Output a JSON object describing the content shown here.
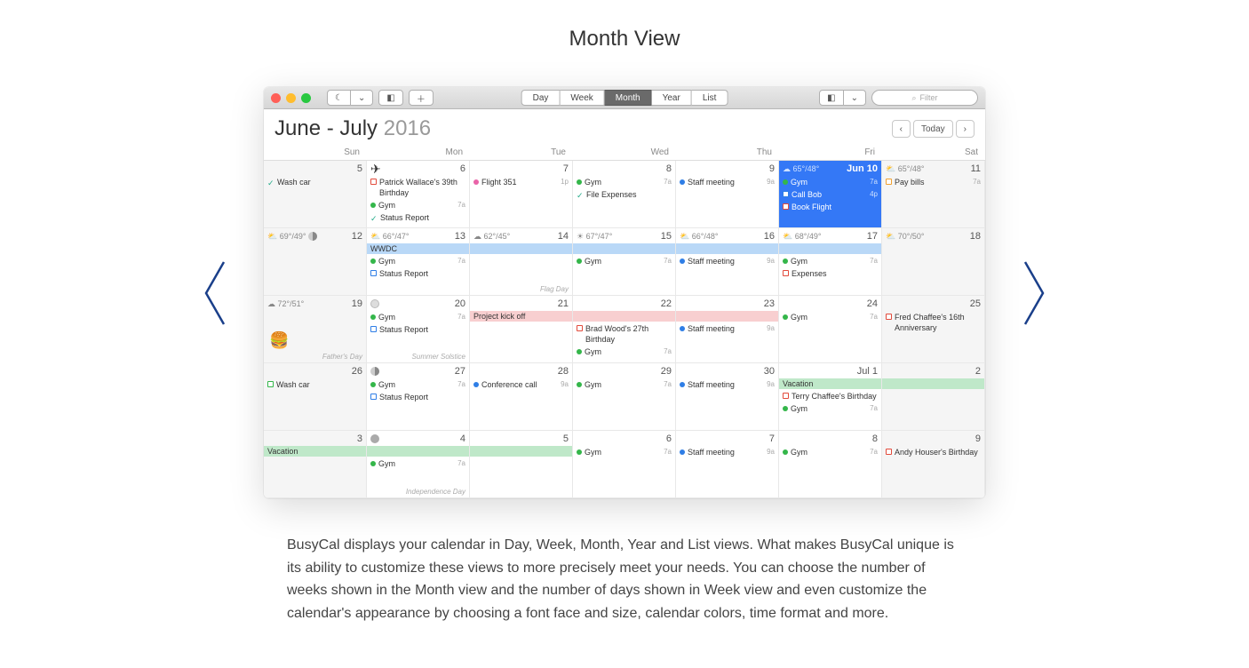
{
  "page_title": "Month View",
  "description": "BusyCal displays your calendar in Day, Week, Month, Year and List views. What makes BusyCal unique is its ability to customize these views to more precisely meet your needs. You can choose the number of weeks shown in the Month view and the number of days shown in Week view and even customize the calendar's appearance by choosing a font face and size, calendar colors, time format and more.",
  "toolbar": {
    "views": [
      "Day",
      "Week",
      "Month",
      "Year",
      "List"
    ],
    "active_view": "Month",
    "filter_placeholder": "Filter"
  },
  "header": {
    "month_range": "June - July",
    "year": "2016",
    "today_label": "Today"
  },
  "weekdays": [
    "Sun",
    "Mon",
    "Tue",
    "Wed",
    "Thu",
    "Fri",
    "Sat"
  ],
  "colors": {
    "blue": "#2f7ee6",
    "green": "#34b64a",
    "red": "#e24a3b",
    "orange": "#f0a030",
    "pink": "#e964a8"
  },
  "cells": [
    {
      "day": "5",
      "weekend": true,
      "events": [
        {
          "type": "check",
          "txt": "Wash car"
        }
      ]
    },
    {
      "day": "6",
      "plane": true,
      "events": [
        {
          "type": "sq",
          "color": "red",
          "txt": "Patrick Wallace's 39th Birthday"
        },
        {
          "type": "dot",
          "color": "green",
          "txt": "Gym",
          "time": "7a"
        },
        {
          "type": "check",
          "txt": "Status Report"
        }
      ]
    },
    {
      "day": "7",
      "events": [
        {
          "type": "dot",
          "color": "pink",
          "txt": "Flight 351",
          "time": "1p"
        }
      ]
    },
    {
      "day": "8",
      "events": [
        {
          "type": "dot",
          "color": "green",
          "txt": "Gym",
          "time": "7a"
        },
        {
          "type": "check",
          "txt": "File Expenses"
        }
      ]
    },
    {
      "day": "9",
      "events": [
        {
          "type": "dot",
          "color": "blue",
          "txt": "Staff meeting",
          "time": "9a"
        }
      ]
    },
    {
      "day": "Jun 10",
      "today": true,
      "weather": "☁ 65°/48°",
      "events": [
        {
          "type": "dot",
          "color": "green",
          "txt": "Gym",
          "time": "7a"
        },
        {
          "type": "sq",
          "color": "blue",
          "txt": "Call Bob",
          "time": "4p"
        },
        {
          "type": "sq",
          "color": "red",
          "txt": "Book Flight"
        }
      ]
    },
    {
      "day": "11",
      "weekend": true,
      "weather": "⛅ 65°/48°",
      "events": [
        {
          "type": "sq",
          "color": "orange",
          "txt": "Pay bills",
          "time": "7a"
        }
      ]
    },
    {
      "day": "12",
      "weekend": true,
      "weather": "⛅ 69°/49°",
      "moon": "half"
    },
    {
      "day": "13",
      "weather": "⛅ 66°/47°",
      "banner": {
        "txt": "WWDC",
        "cls": ""
      },
      "events": [
        {
          "type": "dot",
          "color": "green",
          "txt": "Gym",
          "time": "7a"
        },
        {
          "type": "sq",
          "color": "blue",
          "txt": "Status Report"
        }
      ]
    },
    {
      "day": "14",
      "weather": "☁ 62°/45°",
      "banner_continue": true,
      "note": "Flag Day"
    },
    {
      "day": "15",
      "weather": "☀ 67°/47°",
      "banner_continue": true,
      "events": [
        {
          "type": "dot",
          "color": "green",
          "txt": "Gym",
          "time": "7a"
        }
      ]
    },
    {
      "day": "16",
      "weather": "⛅ 66°/48°",
      "banner_continue": true,
      "events": [
        {
          "type": "dot",
          "color": "blue",
          "txt": "Staff meeting",
          "time": "9a"
        }
      ]
    },
    {
      "day": "17",
      "weather": "⛅ 68°/49°",
      "banner_continue": true,
      "events": [
        {
          "type": "dot",
          "color": "green",
          "txt": "Gym",
          "time": "7a"
        },
        {
          "type": "sq",
          "color": "red",
          "txt": "Expenses"
        }
      ]
    },
    {
      "day": "18",
      "weekend": true,
      "weather": "⛅ 70°/50°"
    },
    {
      "day": "19",
      "weekend": true,
      "weather": "☁ 72°/51°",
      "note": "Father's Day",
      "burger": true
    },
    {
      "day": "20",
      "moon": "full",
      "events": [
        {
          "type": "dot",
          "color": "green",
          "txt": "Gym",
          "time": "7a"
        },
        {
          "type": "sq",
          "color": "blue",
          "txt": "Status Report"
        }
      ],
      "note": "Summer Solstice"
    },
    {
      "day": "21",
      "banner": {
        "txt": "Project kick off",
        "cls": "pink"
      }
    },
    {
      "day": "22",
      "banner_continue_pink": true,
      "events": [
        {
          "type": "sq",
          "color": "red",
          "txt": "Brad Wood's 27th Birthday"
        },
        {
          "type": "dot",
          "color": "green",
          "txt": "Gym",
          "time": "7a"
        }
      ]
    },
    {
      "day": "23",
      "banner_continue_pink": true,
      "events": [
        {
          "type": "dot",
          "color": "blue",
          "txt": "Staff meeting",
          "time": "9a"
        }
      ]
    },
    {
      "day": "24",
      "events": [
        {
          "type": "dot",
          "color": "green",
          "txt": "Gym",
          "time": "7a"
        }
      ]
    },
    {
      "day": "25",
      "weekend": true,
      "events": [
        {
          "type": "sq",
          "color": "red",
          "txt": "Fred Chaffee's 16th Anniversary"
        }
      ]
    },
    {
      "day": "26",
      "weekend": true,
      "events": [
        {
          "type": "sq",
          "color": "green",
          "txt": "Wash car"
        }
      ]
    },
    {
      "day": "27",
      "moon": "half",
      "events": [
        {
          "type": "dot",
          "color": "green",
          "txt": "Gym",
          "time": "7a"
        },
        {
          "type": "sq",
          "color": "blue",
          "txt": "Status Report"
        }
      ]
    },
    {
      "day": "28",
      "events": [
        {
          "type": "dot",
          "color": "blue",
          "txt": "Conference call",
          "time": "9a"
        }
      ]
    },
    {
      "day": "29",
      "events": [
        {
          "type": "dot",
          "color": "green",
          "txt": "Gym",
          "time": "7a"
        }
      ]
    },
    {
      "day": "30",
      "events": [
        {
          "type": "dot",
          "color": "blue",
          "txt": "Staff meeting",
          "time": "9a"
        }
      ]
    },
    {
      "day": "Jul 1",
      "banner": {
        "txt": "Vacation",
        "cls": "green"
      },
      "events": [
        {
          "type": "sq",
          "color": "red",
          "txt": "Terry Chaffee's Birthday"
        },
        {
          "type": "dot",
          "color": "green",
          "txt": "Gym",
          "time": "7a"
        }
      ]
    },
    {
      "day": "2",
      "weekend": true,
      "banner_continue_green": true
    },
    {
      "day": "3",
      "weekend": true,
      "banner": {
        "txt": "Vacation",
        "cls": "green",
        "span": true
      }
    },
    {
      "day": "4",
      "moon": "new",
      "banner_continue_green": true,
      "events": [
        {
          "type": "dot",
          "color": "green",
          "txt": "Gym",
          "time": "7a"
        }
      ],
      "note": "Independence Day"
    },
    {
      "day": "5",
      "banner_continue_green": true,
      "events": []
    },
    {
      "day": "6",
      "events": [
        {
          "type": "dot",
          "color": "green",
          "txt": "Gym",
          "time": "7a"
        }
      ]
    },
    {
      "day": "7",
      "events": [
        {
          "type": "dot",
          "color": "blue",
          "txt": "Staff meeting",
          "time": "9a"
        }
      ]
    },
    {
      "day": "8",
      "events": [
        {
          "type": "dot",
          "color": "green",
          "txt": "Gym",
          "time": "7a"
        }
      ]
    },
    {
      "day": "9",
      "weekend": true,
      "events": [
        {
          "type": "sq",
          "color": "red",
          "txt": "Andy Houser's Birthday"
        }
      ]
    }
  ]
}
